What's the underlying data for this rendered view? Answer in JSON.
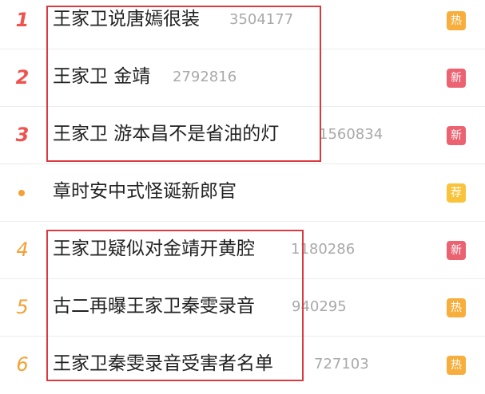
{
  "items": [
    {
      "rank": "1",
      "title": "王家卫说唐嫣很装",
      "count": "3504177",
      "badge": "热",
      "badge_type": "hot",
      "rank_style": "top"
    },
    {
      "rank": "2",
      "title": "王家卫 金靖",
      "count": "2792816",
      "badge": "新",
      "badge_type": "new",
      "rank_style": "top"
    },
    {
      "rank": "3",
      "title": "王家卫 游本昌不是省油的灯",
      "count": "1560834",
      "badge": "新",
      "badge_type": "new",
      "rank_style": "top"
    },
    {
      "rank": "",
      "title": "章时安中式怪诞新郎官",
      "count": "",
      "badge": "荐",
      "badge_type": "rec",
      "rank_style": "dot"
    },
    {
      "rank": "4",
      "title": "王家卫疑似对金靖开黄腔",
      "count": "1180286",
      "badge": "新",
      "badge_type": "new",
      "rank_style": "mid"
    },
    {
      "rank": "5",
      "title": "古二再曝王家卫秦雯录音",
      "count": "940295",
      "badge": "热",
      "badge_type": "hot",
      "rank_style": "mid"
    },
    {
      "rank": "6",
      "title": "王家卫秦雯录音受害者名单",
      "count": "727103",
      "badge": "热",
      "badge_type": "hot",
      "rank_style": "mid"
    }
  ],
  "colors": {
    "rank_top": "#f0524e",
    "rank_other": "#f5a033",
    "badge_hot": "#f8ae3c",
    "badge_new": "#eb6271",
    "badge_rec": "#f9c33c",
    "highlight_box": "#d9393f"
  }
}
